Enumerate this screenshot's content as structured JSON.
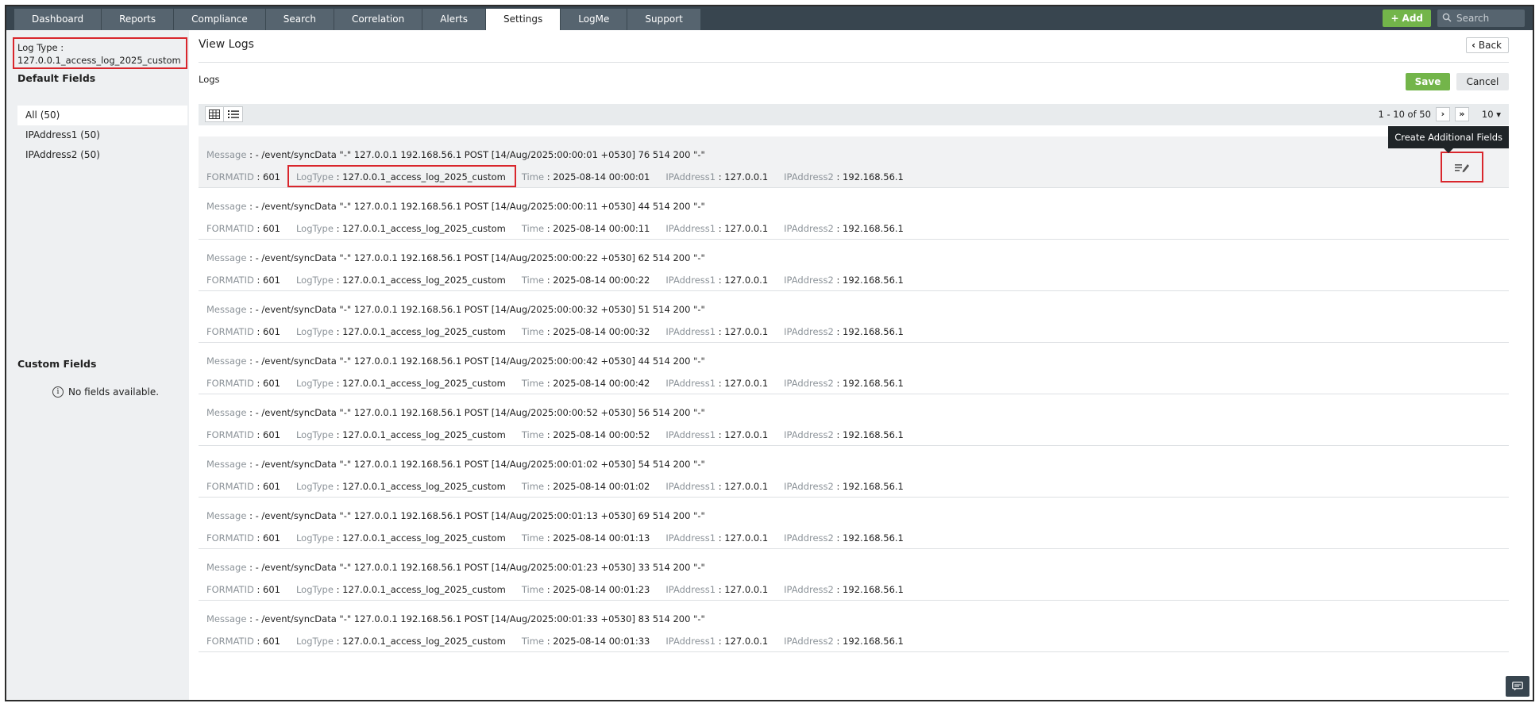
{
  "nav": {
    "tabs": [
      {
        "label": "Dashboard"
      },
      {
        "label": "Reports"
      },
      {
        "label": "Compliance"
      },
      {
        "label": "Search"
      },
      {
        "label": "Correlation"
      },
      {
        "label": "Alerts"
      },
      {
        "label": "Settings"
      },
      {
        "label": "LogMe"
      },
      {
        "label": "Support"
      }
    ],
    "active_tab": "Settings",
    "add_label": "Add",
    "search_placeholder": "Search"
  },
  "sidebar": {
    "logtype_label": "Log Type :",
    "logtype_value": "127.0.0.1_access_log_2025_custom",
    "default_fields_title": "Default Fields",
    "default_fields": [
      {
        "label": "All (50)"
      },
      {
        "label": "IPAddress1 (50)"
      },
      {
        "label": "IPAddress2 (50)"
      }
    ],
    "custom_fields_title": "Custom Fields",
    "no_fields_text": "No fields available."
  },
  "main": {
    "title": "View Logs",
    "back_label": "Back",
    "logs_label": "Logs",
    "save_label": "Save",
    "cancel_label": "Cancel",
    "pager_text": "1 - 10 of 50",
    "page_size": "10",
    "tooltip": "Create Additional Fields",
    "field_keys": {
      "message": "Message",
      "formatid": "FORMATID",
      "logtype": "LogType",
      "time": "Time",
      "ip1": "IPAddress1",
      "ip2": "IPAddress2"
    },
    "rows": [
      {
        "message": ": - /event/syncData \"-\" 127.0.0.1 192.168.56.1 POST [14/Aug/2025:00:00:01 +0530] 76 514 200 \"-\"",
        "formatid": ": 601",
        "logtype": ": 127.0.0.1_access_log_2025_custom",
        "time": ": 2025-08-14 00:00:01",
        "ip1": ": 127.0.0.1",
        "ip2": ": 192.168.56.1"
      },
      {
        "message": ": - /event/syncData \"-\" 127.0.0.1 192.168.56.1 POST [14/Aug/2025:00:00:11 +0530] 44 514 200 \"-\"",
        "formatid": ": 601",
        "logtype": ": 127.0.0.1_access_log_2025_custom",
        "time": ": 2025-08-14 00:00:11",
        "ip1": ": 127.0.0.1",
        "ip2": ": 192.168.56.1"
      },
      {
        "message": ": - /event/syncData \"-\" 127.0.0.1 192.168.56.1 POST [14/Aug/2025:00:00:22 +0530] 62 514 200 \"-\"",
        "formatid": ": 601",
        "logtype": ": 127.0.0.1_access_log_2025_custom",
        "time": ": 2025-08-14 00:00:22",
        "ip1": ": 127.0.0.1",
        "ip2": ": 192.168.56.1"
      },
      {
        "message": ": - /event/syncData \"-\" 127.0.0.1 192.168.56.1 POST [14/Aug/2025:00:00:32 +0530] 51 514 200 \"-\"",
        "formatid": ": 601",
        "logtype": ": 127.0.0.1_access_log_2025_custom",
        "time": ": 2025-08-14 00:00:32",
        "ip1": ": 127.0.0.1",
        "ip2": ": 192.168.56.1"
      },
      {
        "message": ": - /event/syncData \"-\" 127.0.0.1 192.168.56.1 POST [14/Aug/2025:00:00:42 +0530] 44 514 200 \"-\"",
        "formatid": ": 601",
        "logtype": ": 127.0.0.1_access_log_2025_custom",
        "time": ": 2025-08-14 00:00:42",
        "ip1": ": 127.0.0.1",
        "ip2": ": 192.168.56.1"
      },
      {
        "message": ": - /event/syncData \"-\" 127.0.0.1 192.168.56.1 POST [14/Aug/2025:00:00:52 +0530] 56 514 200 \"-\"",
        "formatid": ": 601",
        "logtype": ": 127.0.0.1_access_log_2025_custom",
        "time": ": 2025-08-14 00:00:52",
        "ip1": ": 127.0.0.1",
        "ip2": ": 192.168.56.1"
      },
      {
        "message": ": - /event/syncData \"-\" 127.0.0.1 192.168.56.1 POST [14/Aug/2025:00:01:02 +0530] 54 514 200 \"-\"",
        "formatid": ": 601",
        "logtype": ": 127.0.0.1_access_log_2025_custom",
        "time": ": 2025-08-14 00:01:02",
        "ip1": ": 127.0.0.1",
        "ip2": ": 192.168.56.1"
      },
      {
        "message": ": - /event/syncData \"-\" 127.0.0.1 192.168.56.1 POST [14/Aug/2025:00:01:13 +0530] 69 514 200 \"-\"",
        "formatid": ": 601",
        "logtype": ": 127.0.0.1_access_log_2025_custom",
        "time": ": 2025-08-14 00:01:13",
        "ip1": ": 127.0.0.1",
        "ip2": ": 192.168.56.1"
      },
      {
        "message": ": - /event/syncData \"-\" 127.0.0.1 192.168.56.1 POST [14/Aug/2025:00:01:23 +0530] 33 514 200 \"-\"",
        "formatid": ": 601",
        "logtype": ": 127.0.0.1_access_log_2025_custom",
        "time": ": 2025-08-14 00:01:23",
        "ip1": ": 127.0.0.1",
        "ip2": ": 192.168.56.1"
      },
      {
        "message": ": - /event/syncData \"-\" 127.0.0.1 192.168.56.1 POST [14/Aug/2025:00:01:33 +0530] 83 514 200 \"-\"",
        "formatid": ": 601",
        "logtype": ": 127.0.0.1_access_log_2025_custom",
        "time": ": 2025-08-14 00:01:33",
        "ip1": ": 127.0.0.1",
        "ip2": ": 192.168.56.1"
      }
    ]
  },
  "colors": {
    "topbar": "#38454f",
    "tab": "#56646f",
    "accent_green": "#73b54a",
    "highlight_red": "#d9262c"
  },
  "icons": {
    "search": "search-icon",
    "back": "chevron-left-icon",
    "grid_view": "grid-view-icon",
    "list_view": "list-view-icon",
    "next": "chevron-right-icon",
    "last": "double-chevron-right-icon",
    "page_size_caret": "caret-down-icon",
    "row_action": "edit-fields-icon",
    "chat": "chat-icon",
    "info": "info-icon"
  }
}
